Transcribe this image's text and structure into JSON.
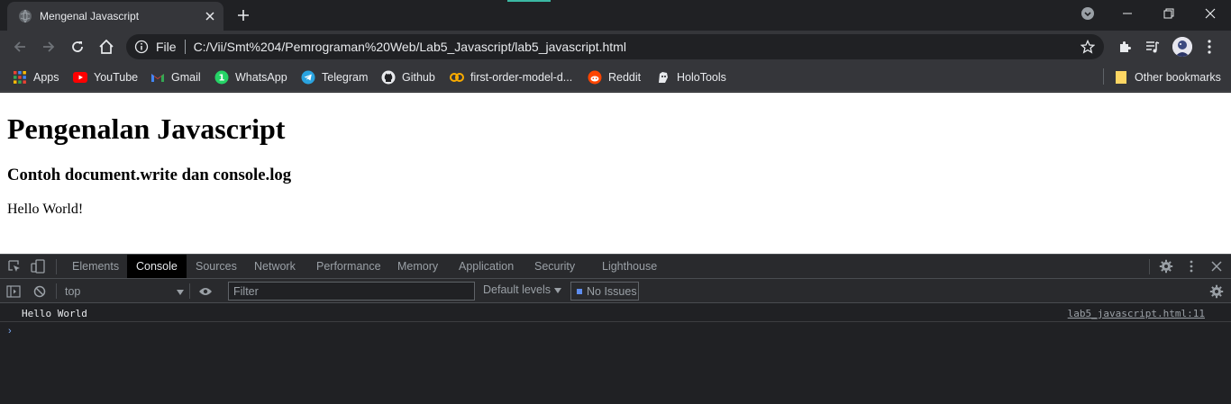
{
  "browser": {
    "tab": {
      "title": "Mengenal Javascript"
    },
    "omnibox": {
      "scheme": "File",
      "url": "C:/Vii/Smt%204/Pemrograman%20Web/Lab5_Javascript/lab5_javascript.html"
    },
    "bookmarks": [
      {
        "label": "Apps",
        "icon": "apps-grid-icon",
        "color": "#ea4335"
      },
      {
        "label": "YouTube",
        "icon": "youtube-icon",
        "color": "#ff0000"
      },
      {
        "label": "Gmail",
        "icon": "gmail-icon",
        "color": "#ea4335"
      },
      {
        "label": "WhatsApp",
        "icon": "whatsapp-icon",
        "color": "#25d366"
      },
      {
        "label": "Telegram",
        "icon": "telegram-icon",
        "color": "#2aa3df"
      },
      {
        "label": "Github",
        "icon": "github-icon",
        "color": "#e8eaed"
      },
      {
        "label": "first-order-model-d...",
        "icon": "colab-icon",
        "color": "#f9ab00"
      },
      {
        "label": "Reddit",
        "icon": "reddit-icon",
        "color": "#ff4500"
      },
      {
        "label": "HoloTools",
        "icon": "holotools-icon",
        "color": "#e8eaed"
      }
    ],
    "other_bookmarks": "Other bookmarks"
  },
  "page": {
    "heading": "Pengenalan Javascript",
    "subheading": "Contoh document.write dan console.log",
    "paragraph": "Hello World!"
  },
  "devtools": {
    "tabs": [
      {
        "label": "Elements",
        "active": false
      },
      {
        "label": "Console",
        "active": true
      },
      {
        "label": "Sources",
        "active": false
      },
      {
        "label": "Network",
        "active": false
      },
      {
        "label": "Performance",
        "active": false
      },
      {
        "label": "Memory",
        "active": false
      },
      {
        "label": "Application",
        "active": false
      },
      {
        "label": "Security",
        "active": false
      },
      {
        "label": "Lighthouse",
        "active": false
      }
    ],
    "console": {
      "context": "top",
      "filter_placeholder": "Filter",
      "levels": "Default levels",
      "issues": "No Issues",
      "messages": [
        {
          "text": "Hello World",
          "source": "lab5_javascript.html:11"
        }
      ],
      "prompt": "›"
    }
  },
  "colors": {
    "chrome_dark": "#202124",
    "chrome_toolbar": "#35363a",
    "devtools_bar": "#292a2d",
    "page_bg": "#ffffff",
    "accent_blue": "#7cacf8"
  }
}
